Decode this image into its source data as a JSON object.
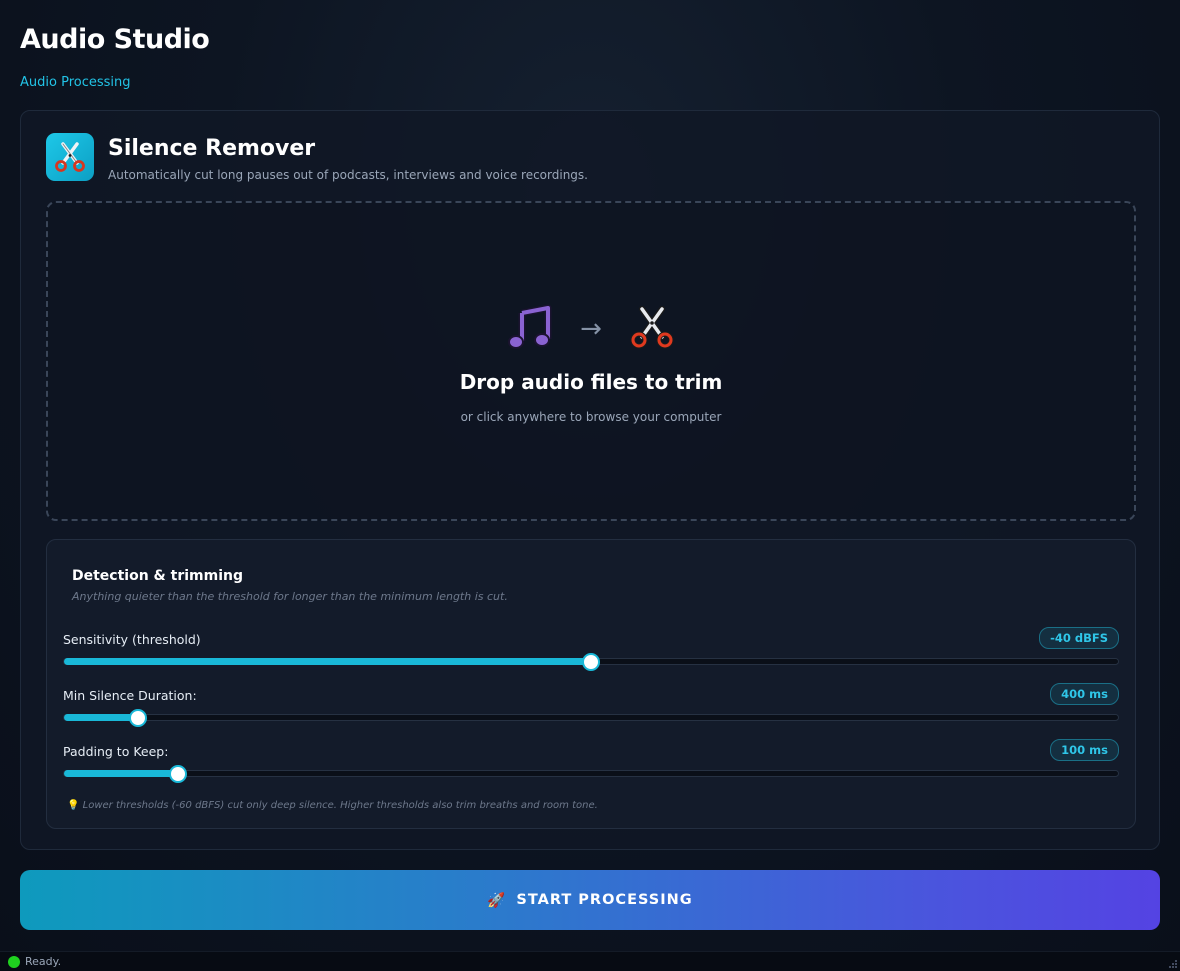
{
  "app": {
    "title": "Audio Studio",
    "subtitle": "Audio Processing",
    "accent": "#22c3e6"
  },
  "tool": {
    "title": "Silence Remover",
    "description": "Automatically cut long pauses out of podcasts, interviews and voice recordings.",
    "icon": "scissors-icon"
  },
  "dropzone": {
    "title": "Drop audio files to trim",
    "hint": "or click anywhere to browse your computer",
    "icons": [
      "music-note-icon",
      "arrow-right-icon",
      "scissors-icon"
    ]
  },
  "settings": {
    "title": "Detection & trimming",
    "subtitle": "Anything quieter than the threshold for longer than the minimum length is cut.",
    "params": [
      {
        "label": "Sensitivity (threshold)",
        "value": "-40 dBFS",
        "fraction": 0.5
      },
      {
        "label": "Min Silence Duration:",
        "value": "400 ms",
        "fraction": 0.07
      },
      {
        "label": "Padding to Keep:",
        "value": "100 ms",
        "fraction": 0.108
      }
    ],
    "tip": "Lower thresholds (-60 dBFS) cut only deep silence. Higher thresholds also trim breaths and room tone.",
    "tip_icon": "lightbulb-icon"
  },
  "actions": {
    "start_label": "START PROCESSING",
    "start_icon": "rocket-icon"
  },
  "status": {
    "text": "Ready.",
    "color": "#1fd11f"
  }
}
